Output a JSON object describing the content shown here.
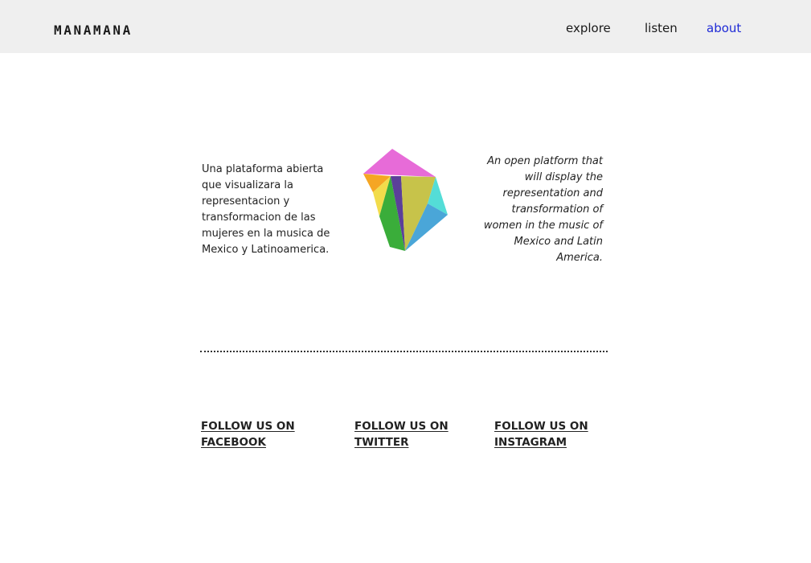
{
  "header": {
    "brand": "MANAMANA",
    "nav": [
      {
        "label": "explore"
      },
      {
        "label": "listen"
      },
      {
        "label": "about"
      }
    ],
    "active_color": "#1f2bd6"
  },
  "intro": {
    "spanish": "Una plataforma abierta que visualizara la representacion y transformacion de las mujeres en la musica de Mexico y Latinoamerica.",
    "english": "An open platform that will display the representation and transformation of women in the music of Mexico and Latin America."
  },
  "logo": {
    "icon": "gem-logo-icon",
    "colors": [
      "#e76bd8",
      "#f5a623",
      "#f2dc4b",
      "#3aad3a",
      "#5b3f99",
      "#c7c34a",
      "#54ddd7",
      "#4aa6d8"
    ]
  },
  "social": [
    {
      "line1": "FOLLOW US ON",
      "line2": "FACEBOOK"
    },
    {
      "line1": "FOLLOW US ON",
      "line2": "TWITTER"
    },
    {
      "line1": "FOLLOW US ON",
      "line2": "INSTAGRAM"
    }
  ]
}
